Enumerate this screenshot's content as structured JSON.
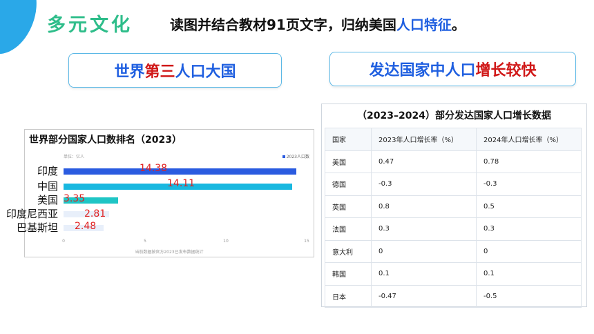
{
  "section_title": "多元文化",
  "instruction": {
    "before": "读图并结合教材91页文字，归纳美国",
    "highlight": "人口特征",
    "after": "。"
  },
  "pill_left": {
    "a": "世界",
    "b": "第三",
    "c": "人口大国"
  },
  "pill_right": {
    "a": "发达国家中人口",
    "b": "增长较快"
  },
  "ranking": {
    "title": "世界部分国家人口数排名（2023）",
    "unit": "单位：亿人",
    "legend": "2023人口数",
    "note": "当前数据按官方2023已发布数据统计",
    "ticks": [
      "0",
      "5",
      "10",
      "15"
    ],
    "countries": [
      "印度",
      "中国",
      "美国",
      "印度尼西亚",
      "巴基斯坦"
    ],
    "values_text": [
      "14.38",
      "14.11",
      "3.35",
      "2.81",
      "2.48"
    ]
  },
  "chart_data": {
    "type": "bar",
    "title": "世界部分国家人口数排名（2023）",
    "categories": [
      "印度",
      "中国",
      "美国",
      "印度尼西亚",
      "巴基斯坦"
    ],
    "values": [
      14.38,
      14.11,
      3.35,
      2.81,
      2.48
    ],
    "xlim": [
      0,
      15
    ],
    "orientation": "horizontal",
    "colors": [
      "#2a5be0",
      "#19b8e0",
      "#1fc5c5",
      "#e8effa",
      "#e8effa"
    ]
  },
  "growth_table": {
    "title": "（2023–2024）部分发达国家人口增长数据",
    "headers": [
      "国家",
      "2023年人口增长率（%）",
      "2024年人口增长率（%）"
    ],
    "rows": [
      [
        "美国",
        "0.47",
        "0.78"
      ],
      [
        "德国",
        "-0.3",
        "-0.3"
      ],
      [
        "英国",
        "0.8",
        "0.5"
      ],
      [
        "法国",
        "0.3",
        "0.3"
      ],
      [
        "意大利",
        "0",
        "0"
      ],
      [
        "韩国",
        "0.1",
        "0.1"
      ],
      [
        "日本",
        "-0.47",
        "-0.5"
      ]
    ]
  }
}
